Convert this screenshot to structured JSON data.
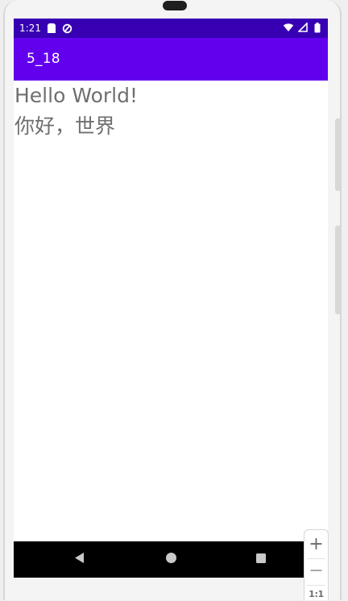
{
  "status_bar": {
    "time": "1:21",
    "icons_left": [
      "sd-card-icon",
      "sync-icon"
    ],
    "icons_right": [
      "wifi-icon",
      "signal-icon",
      "battery-icon"
    ]
  },
  "app_bar": {
    "title": "5_18"
  },
  "content": {
    "line_en": "Hello World!",
    "line_zh": "你好，世界"
  },
  "navigation": {
    "buttons": [
      "back",
      "home",
      "recents"
    ]
  },
  "zoom_controls": {
    "zoom_in": "+",
    "zoom_out": "−",
    "actual_size": "1:1"
  },
  "colors": {
    "status_bar": "#3700b3",
    "app_bar": "#6200ee",
    "text": "#6f6f6f",
    "nav_bar": "#000000"
  }
}
